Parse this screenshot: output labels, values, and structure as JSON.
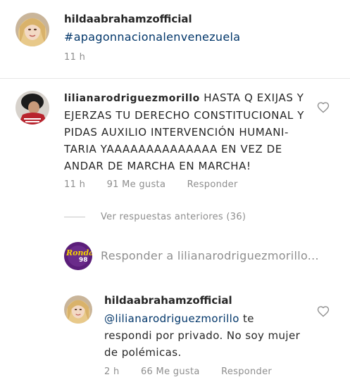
{
  "post": {
    "username": "hildaabrahamzofficial",
    "hashtag": "#apagonnacionalenvenezuela",
    "time": "11 h"
  },
  "comment": {
    "username": "lilianarodriguezmorillo",
    "text": "HASTA Q EXIJAS Y EJERZAS TU DERECHO CONSTITUCIONAL Y PIDAS AUXILIO INTERVENCIÓN HUMANI-TARIA YAAAAAAAAAAAAAA EN VEZ DE ANDAR DE MARCHA EN MARCHA!",
    "lines": [
      "HASTA Q EXIJAS Y",
      "EJERZAS TU DERECHO CONSTITUCIONAL Y",
      "PIDAS AUXILIO INTERVENCIÓN HUMANI-",
      "TARIA YAAAAAAAAAAAAAA EN VEZ DE",
      "ANDAR DE MARCHA EN MARCHA!"
    ],
    "time": "11 h",
    "likes": "91 Me gusta",
    "reply_label": "Responder"
  },
  "view_previous": "Ver respuestas anteriores (36)",
  "reply_box": {
    "avatar_text": "Ronda",
    "avatar_sub": "98",
    "placeholder": "Responder a lilianarodriguezmorillo..."
  },
  "reply": {
    "username": "hildaabrahamzofficial",
    "mention": "@lilianarodriguezmorillo",
    "line1_rest": " te",
    "line2": "respondi por privado. No soy mujer",
    "line3": "de polémicas.",
    "time": "2 h",
    "likes": "66 Me gusta",
    "reply_label": "Responder"
  },
  "colors": {
    "link": "#003569",
    "meta": "#8e8e8e",
    "ronda_purple": "#5b1e7a",
    "ronda_yellow": "#f5d000"
  }
}
